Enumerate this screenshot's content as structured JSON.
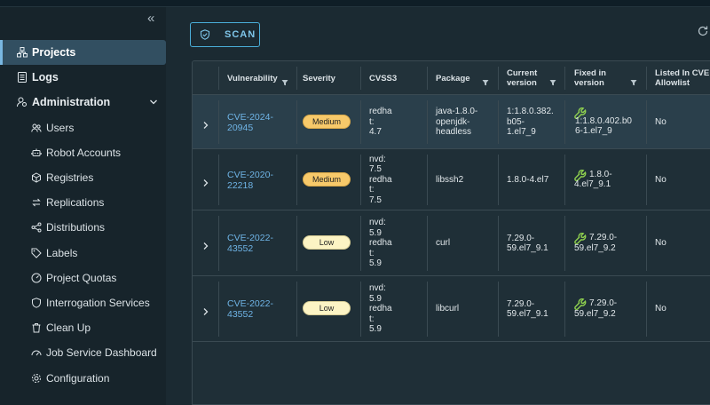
{
  "sidebar": {
    "projects": "Projects",
    "logs": "Logs",
    "administration": "Administration",
    "items": [
      {
        "label": "Users",
        "icon": "users-icon"
      },
      {
        "label": "Robot Accounts",
        "icon": "robot-icon"
      },
      {
        "label": "Registries",
        "icon": "cube-icon"
      },
      {
        "label": "Replications",
        "icon": "replication-icon"
      },
      {
        "label": "Distributions",
        "icon": "share-icon"
      },
      {
        "label": "Labels",
        "icon": "tag-icon"
      },
      {
        "label": "Project Quotas",
        "icon": "gauge-icon"
      },
      {
        "label": "Interrogation Services",
        "icon": "shield-icon"
      },
      {
        "label": "Clean Up",
        "icon": "trash-icon"
      },
      {
        "label": "Job Service Dashboard",
        "icon": "dashboard-icon"
      },
      {
        "label": "Configuration",
        "icon": "gear-icon"
      }
    ]
  },
  "toolbar": {
    "scan_label": "SCAN"
  },
  "table": {
    "headers": {
      "vulnerability": "Vulnerability",
      "severity": "Severity",
      "cvss3": "CVSS3",
      "package": "Package",
      "current_line1": "Current",
      "current_line2": "version",
      "fixed_line1": "Fixed in",
      "fixed_line2": "version",
      "allow_line1": "Listed In CVE",
      "allow_line2": "Allowlist"
    },
    "rows": [
      {
        "cve": [
          "CVE-2024-",
          "20945"
        ],
        "severity": "Medium",
        "cvss": [
          "redha",
          "t:",
          "4.7"
        ],
        "package": [
          "java-1.8.0-",
          "openjdk-",
          "headless"
        ],
        "current": [
          "1:1.8.0.382.",
          "b05-",
          "1.el7_9"
        ],
        "fixed": [
          "1:1.8.0.402.b0",
          "6-1.el7_9"
        ],
        "allowlist": "No"
      },
      {
        "cve": [
          "CVE-2020-",
          "22218"
        ],
        "severity": "Medium",
        "cvss": [
          "nvd:",
          "7.5",
          "redha",
          "t:",
          "7.5"
        ],
        "package": [
          "libssh2"
        ],
        "current": [
          "1.8.0-4.el7"
        ],
        "fixed": [
          "1.8.0-",
          "4.el7_9.1"
        ],
        "allowlist": "No"
      },
      {
        "cve": [
          "CVE-2022-",
          "43552"
        ],
        "severity": "Low",
        "cvss": [
          "nvd:",
          "5.9",
          "redha",
          "t:",
          "5.9"
        ],
        "package": [
          "curl"
        ],
        "current": [
          "7.29.0-",
          "59.el7_9.1"
        ],
        "fixed": [
          "7.29.0-",
          "59.el7_9.2"
        ],
        "allowlist": "No"
      },
      {
        "cve": [
          "CVE-2022-",
          "43552"
        ],
        "severity": "Low",
        "cvss": [
          "nvd:",
          "5.9",
          "redha",
          "t:",
          "5.9"
        ],
        "package": [
          "libcurl"
        ],
        "current": [
          "7.29.0-",
          "59.el7_9.1"
        ],
        "fixed": [
          "7.29.0-",
          "59.el7_9.2"
        ],
        "allowlist": "No"
      }
    ]
  },
  "colors": {
    "accent": "#79b7e1",
    "link": "#6fb4e6",
    "medium": "#f7c96a",
    "low": "#fcf4c4",
    "fix_icon": "#8fd14f"
  }
}
